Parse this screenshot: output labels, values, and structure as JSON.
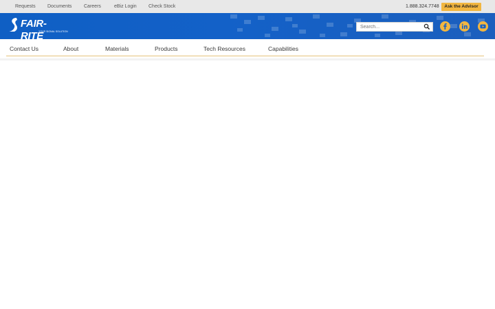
{
  "utility": {
    "links": [
      "Requests",
      "Documents",
      "Careers",
      "eBiz Login",
      "Check Stock"
    ],
    "phone": "1.888.324.7748",
    "advisor_label": "Ask the Advisor",
    "advisor_color": "#f2b640"
  },
  "header": {
    "logo_text": "FAIR-RITE",
    "logo_tagline": "YOUR SIGNAL SOLUTION",
    "brand_color": "#1361c8"
  },
  "search": {
    "placeholder": "Search...",
    "icon": "search-icon"
  },
  "social": {
    "icons": [
      "facebook-icon",
      "linkedin-icon",
      "youtube-icon"
    ]
  },
  "nav": {
    "items": [
      "Contact Us",
      "About",
      "Materials",
      "Products",
      "Tech Resources",
      "Capabilities"
    ]
  }
}
